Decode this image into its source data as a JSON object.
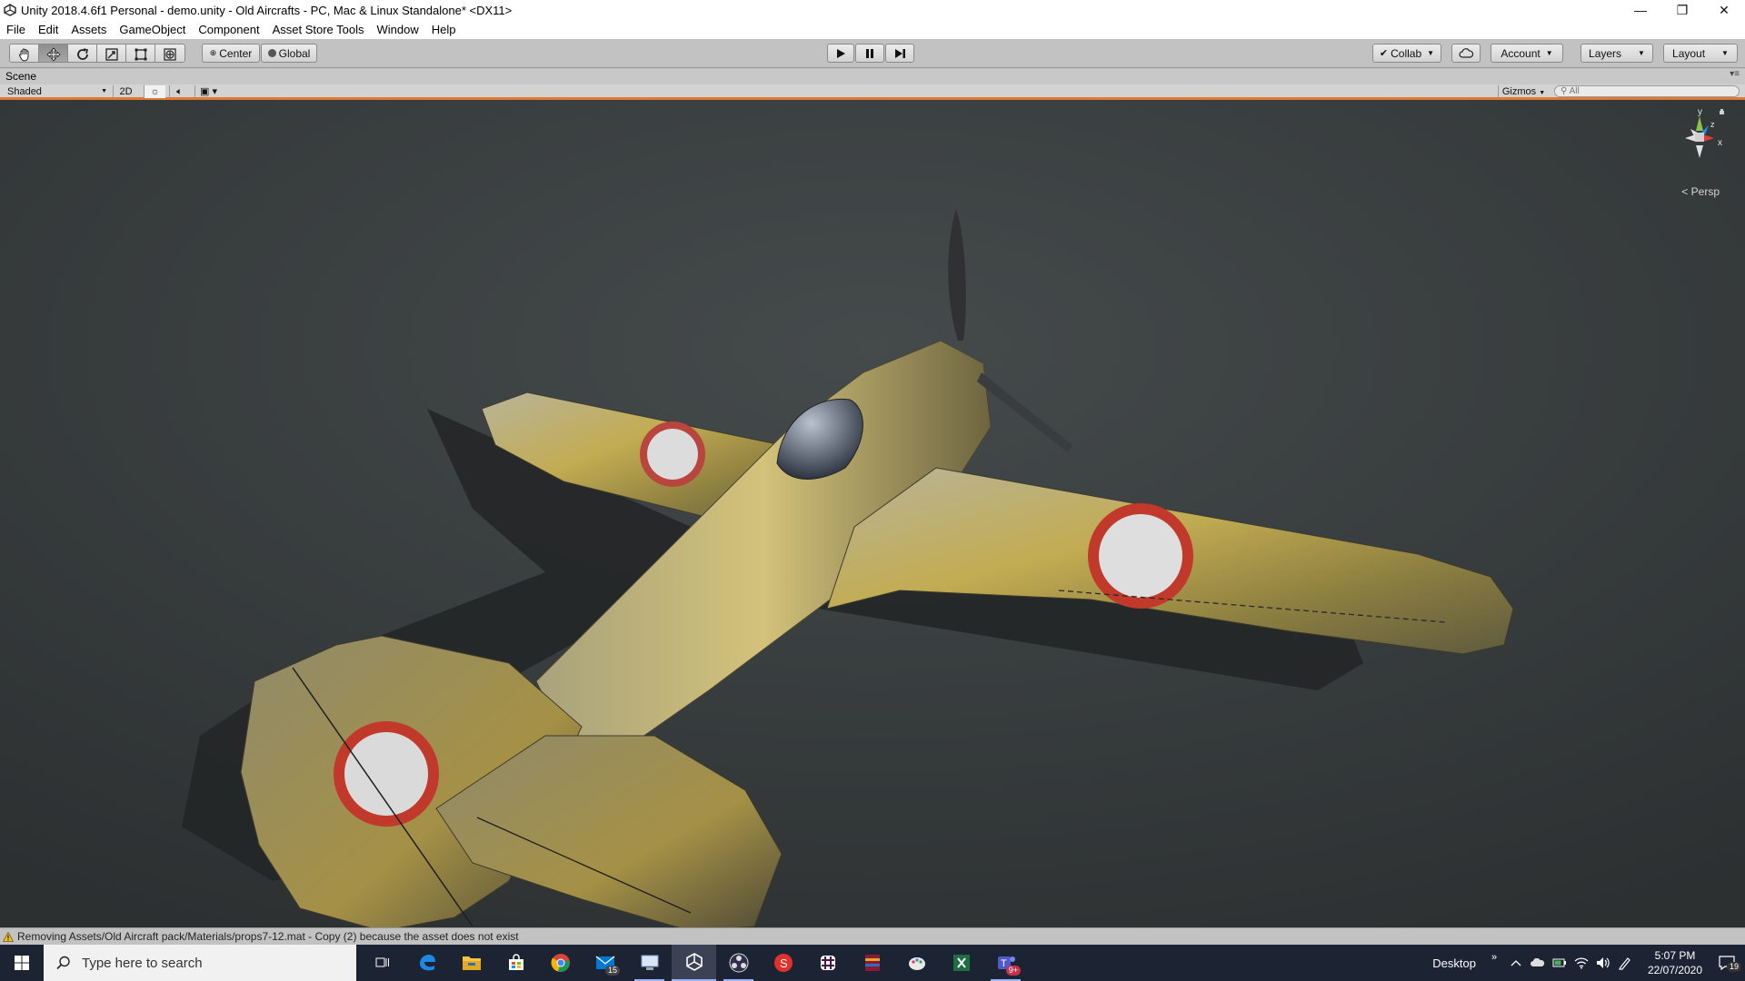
{
  "window": {
    "title": "Unity 2018.4.6f1 Personal - demo.unity - Old Aircrafts - PC, Mac & Linux Standalone* <DX11>",
    "controls": {
      "minimize": "—",
      "restore": "❐",
      "close": "✕"
    }
  },
  "menu": [
    "File",
    "Edit",
    "Assets",
    "GameObject",
    "Component",
    "Asset Store Tools",
    "Window",
    "Help"
  ],
  "toolbar": {
    "tools": [
      "hand-tool",
      "move-tool",
      "rotate-tool",
      "scale-tool",
      "rect-tool",
      "transform-tool"
    ],
    "active_tool_index": 1,
    "pivot_label": "Center",
    "space_label": "Global",
    "collab_label": "Collab",
    "account_label": "Account",
    "layers_label": "Layers",
    "layout_label": "Layout"
  },
  "scene": {
    "tab_label": "Scene",
    "draw_mode": "Shaded",
    "mode_2d": "2D",
    "gizmos_label": "Gizmos",
    "search_placeholder": "All",
    "projection_label": "Persp",
    "axes": {
      "x": "x",
      "y": "y",
      "z": "z"
    }
  },
  "console": {
    "message": "Removing Assets/Old Aircraft pack/Materials/props7-12.mat - Copy (2) because the asset does not exist"
  },
  "taskbar": {
    "search_placeholder": "Type here to search",
    "apps": [
      {
        "name": "task-view-icon"
      },
      {
        "name": "edge-icon"
      },
      {
        "name": "file-explorer-icon"
      },
      {
        "name": "store-icon"
      },
      {
        "name": "chrome-icon"
      },
      {
        "name": "mail-icon",
        "badge": "15"
      },
      {
        "name": "remote-app-icon"
      },
      {
        "name": "unity-icon",
        "active": true
      },
      {
        "name": "obs-icon"
      },
      {
        "name": "substance-icon"
      },
      {
        "name": "slack-icon"
      },
      {
        "name": "winrar-icon"
      },
      {
        "name": "paint-icon"
      },
      {
        "name": "excel-icon"
      },
      {
        "name": "teams-icon",
        "badge": "9+"
      }
    ],
    "tray": {
      "desktop_label": "Desktop",
      "time": "5:07 PM",
      "date": "22/07/2020",
      "notifications": "19"
    }
  },
  "colors": {
    "scene_border": "#e07a32",
    "viewport_bg": "#373b3c",
    "roundel_red": "#c0392b",
    "taskbar_bg": "#1c2333"
  }
}
